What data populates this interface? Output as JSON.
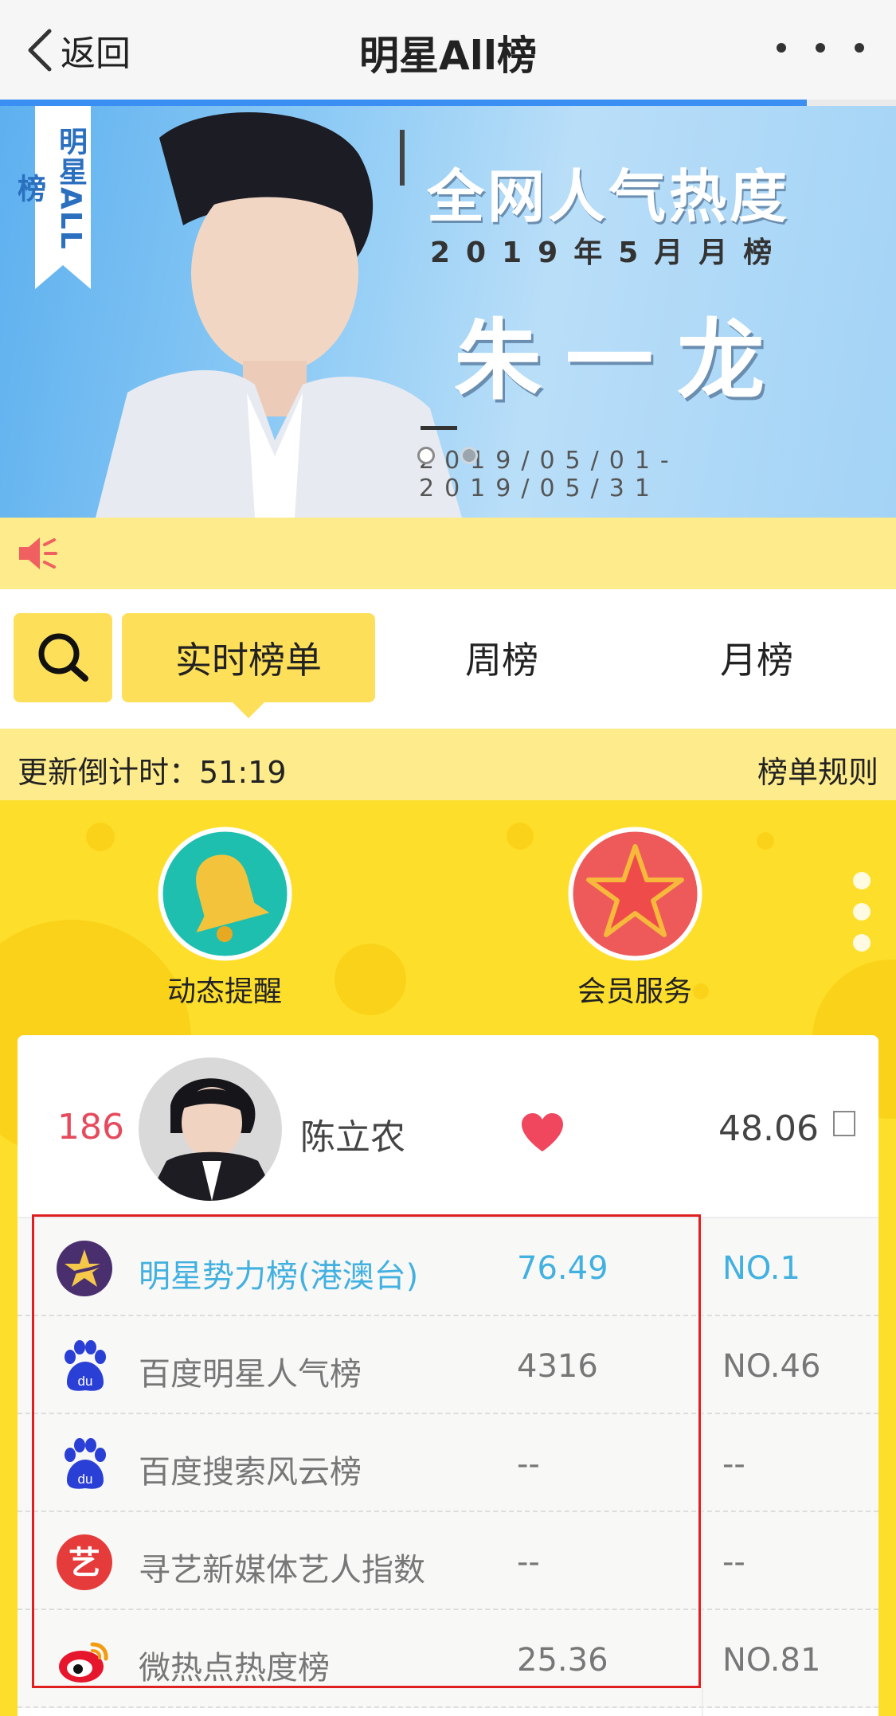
{
  "nav": {
    "back_label": "返回",
    "title": "明星All榜"
  },
  "banner": {
    "tag": "明星ALL榜",
    "headline": "全网人气热度",
    "subtitle": "2019年5月月榜",
    "name": "朱一龙",
    "dates": "2019/05/01-2019/05/31"
  },
  "tabs": {
    "items": [
      {
        "label": "实时榜单",
        "active": true
      },
      {
        "label": "周榜",
        "active": false
      },
      {
        "label": "月榜",
        "active": false
      }
    ]
  },
  "countdown": {
    "label": "更新倒计时：51:19",
    "rules_label": "榜单规则"
  },
  "features": [
    {
      "label": "动态提醒",
      "icon": "bell-icon",
      "color": "#1fbfb0"
    },
    {
      "label": "会员服务",
      "icon": "star-icon",
      "color": "#ee5a5a"
    }
  ],
  "star": {
    "rank": "186",
    "name": "陈立农",
    "score": "48.06"
  },
  "rankings": [
    {
      "name": "明星势力榜(港澳台)",
      "value": "76.49",
      "rank": "NO.1",
      "icon": "star-logo-icon",
      "highlight": true
    },
    {
      "name": "百度明星人气榜",
      "value": "4316",
      "rank": "NO.46",
      "icon": "baidu-paw-icon",
      "highlight": false
    },
    {
      "name": "百度搜索风云榜",
      "value": "--",
      "rank": "--",
      "icon": "baidu-paw-icon",
      "highlight": false
    },
    {
      "name": "寻艺新媒体艺人指数",
      "value": "--",
      "rank": "--",
      "icon": "xunyi-logo-icon",
      "highlight": false
    },
    {
      "name": "微热点热度榜",
      "value": "25.36",
      "rank": "NO.81",
      "icon": "weibo-logo-icon",
      "highlight": false
    }
  ],
  "colors": {
    "accent_yellow": "#fddf59",
    "notice_yellow": "#fdeb8c",
    "feature_yellow": "#fddf2b",
    "highlight_blue": "#42b0e0",
    "rank_red": "#e64a5d",
    "progress_blue": "#3b8ef2"
  },
  "page_progress": 0.9
}
